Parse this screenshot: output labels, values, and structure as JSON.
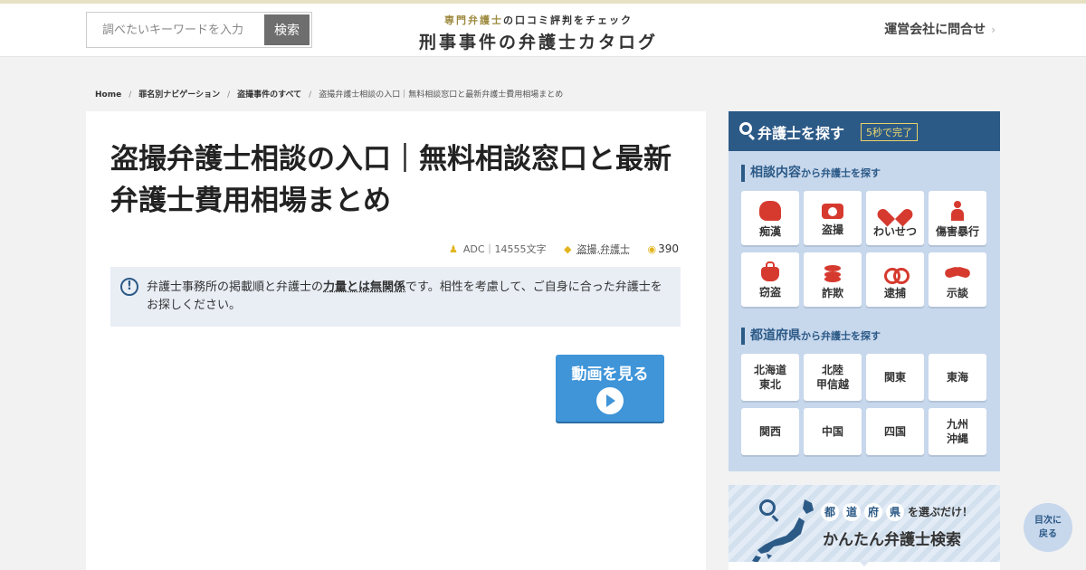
{
  "header": {
    "search_placeholder": "調べたいキーワードを入力",
    "search_button": "検索",
    "logo_sub_highlight": "専門弁護士",
    "logo_sub_rest": "の口コミ評判をチェック",
    "logo_main": "刑事事件の弁護士カタログ",
    "contact_label": "運営会社に問合せ",
    "contact_chevron": "›"
  },
  "breadcrumb": {
    "items": [
      "Home",
      "罪名別ナビゲーション",
      "盗撮事件のすべて"
    ],
    "separator": "/",
    "current": "盗撮弁護士相談の入口｜無料相談窓口と最新弁護士費用相場まとめ"
  },
  "article": {
    "title": "盗撮弁護士相談の入口｜無料相談窓口と最新弁護士費用相場まとめ",
    "author": "ADC｜14555文字",
    "tag1": "盗撮",
    "tag_sep": ",",
    "tag2": "弁護士",
    "view_count": "390",
    "notice_icon": "!",
    "notice_pre": "弁護士事務所の掲載順と弁護士の",
    "notice_em1": "力量とは無関係",
    "notice_post": "です。相性を考慮して、ご自身に合った弁護士をお探しください。",
    "video_label": "動画を見る"
  },
  "sidebar": {
    "title": "弁護士を探す",
    "badge": "5秒で完了",
    "section1_strong": "相談内容",
    "section1_small": "から弁護士を探す",
    "crimes": [
      {
        "label": "痴漢",
        "icon": "hand-icon"
      },
      {
        "label": "盗撮",
        "icon": "camera-icon"
      },
      {
        "label": "わいせつ",
        "icon": "broken-heart-icon"
      },
      {
        "label": "傷害暴行",
        "icon": "person-icon"
      },
      {
        "label": "窃盗",
        "icon": "bag-icon"
      },
      {
        "label": "詐欺",
        "icon": "coins-icon"
      },
      {
        "label": "逮捕",
        "icon": "handcuffs-icon"
      },
      {
        "label": "示談",
        "icon": "handshake-icon"
      }
    ],
    "section2_strong": "都道府県",
    "section2_small": "から弁護士を探す",
    "regions": [
      "北海道\n東北",
      "北陸\n甲信越",
      "関東",
      "東海",
      "関西",
      "中国",
      "四国",
      "九州\n沖縄"
    ]
  },
  "banner": {
    "chars": [
      "都",
      "道",
      "府",
      "県"
    ],
    "line1_rest": "を選ぶだけ！",
    "line2": "かんたん弁護士検索"
  },
  "toc": {
    "label_line1": "目次に",
    "label_line2": "戻る"
  },
  "colors": {
    "accent": "#2c5a87",
    "video": "#3f95d8",
    "icon_red": "#d63a2f",
    "logo_gold": "#9e8a3f"
  }
}
